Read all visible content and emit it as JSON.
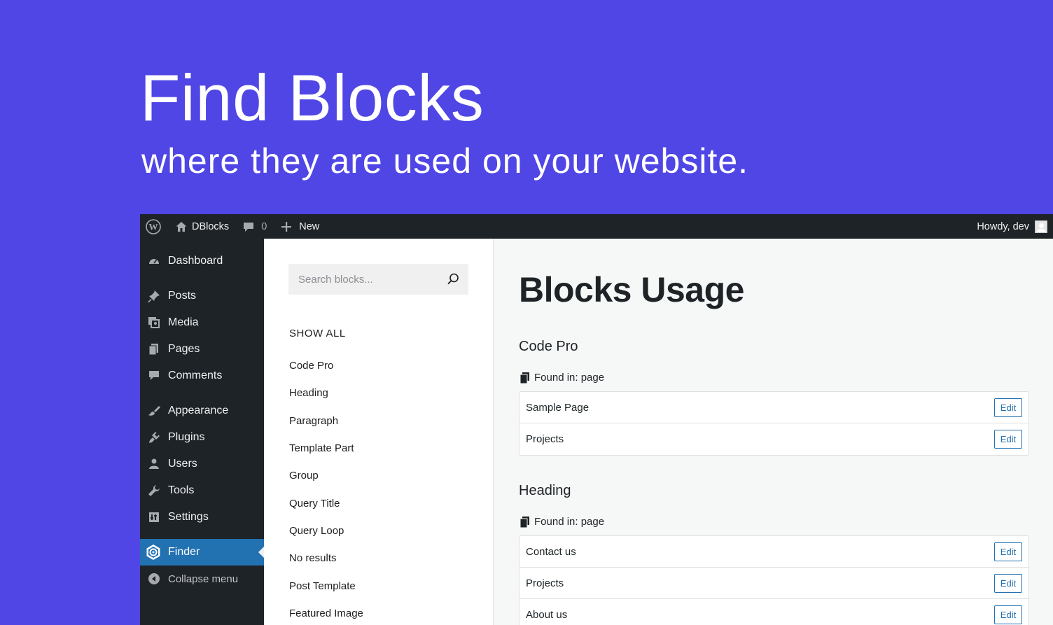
{
  "hero": {
    "title": "Find Blocks",
    "subtitle": "where they are used on your website."
  },
  "adminbar": {
    "site_name": "DBlocks",
    "comments_count": "0",
    "new_label": "New",
    "greeting": "Howdy, dev"
  },
  "sidebar": {
    "items": [
      {
        "label": "Dashboard",
        "icon": "dashboard-icon"
      },
      {
        "label": "Posts",
        "icon": "pin-icon"
      },
      {
        "label": "Media",
        "icon": "media-icon"
      },
      {
        "label": "Pages",
        "icon": "pages-icon"
      },
      {
        "label": "Comments",
        "icon": "comment-icon"
      },
      {
        "label": "Appearance",
        "icon": "brush-icon"
      },
      {
        "label": "Plugins",
        "icon": "plugin-icon"
      },
      {
        "label": "Users",
        "icon": "user-icon"
      },
      {
        "label": "Tools",
        "icon": "wrench-icon"
      },
      {
        "label": "Settings",
        "icon": "settings-icon"
      },
      {
        "label": "Finder",
        "icon": "finder-icon",
        "active": true
      },
      {
        "label": "Collapse menu",
        "icon": "collapse-icon"
      }
    ]
  },
  "panel": {
    "search_placeholder": "Search blocks...",
    "show_all": "SHOW ALL",
    "blocks": [
      "Code Pro",
      "Heading",
      "Paragraph",
      "Template Part",
      "Group",
      "Query Title",
      "Query Loop",
      "No results",
      "Post Template",
      "Featured Image"
    ]
  },
  "content": {
    "title": "Blocks Usage",
    "groups": [
      {
        "name": "Code Pro",
        "found_in": "Found in: page",
        "rows": [
          {
            "title": "Sample Page",
            "action": "Edit"
          },
          {
            "title": "Projects",
            "action": "Edit"
          }
        ]
      },
      {
        "name": "Heading",
        "found_in": "Found in: page",
        "rows": [
          {
            "title": "Contact us",
            "action": "Edit"
          },
          {
            "title": "Projects",
            "action": "Edit"
          },
          {
            "title": "About us",
            "action": "Edit"
          }
        ]
      }
    ]
  },
  "colors": {
    "brand_background": "#4f46e5",
    "admin_dark": "#1d2327",
    "active_blue": "#2271b1"
  }
}
